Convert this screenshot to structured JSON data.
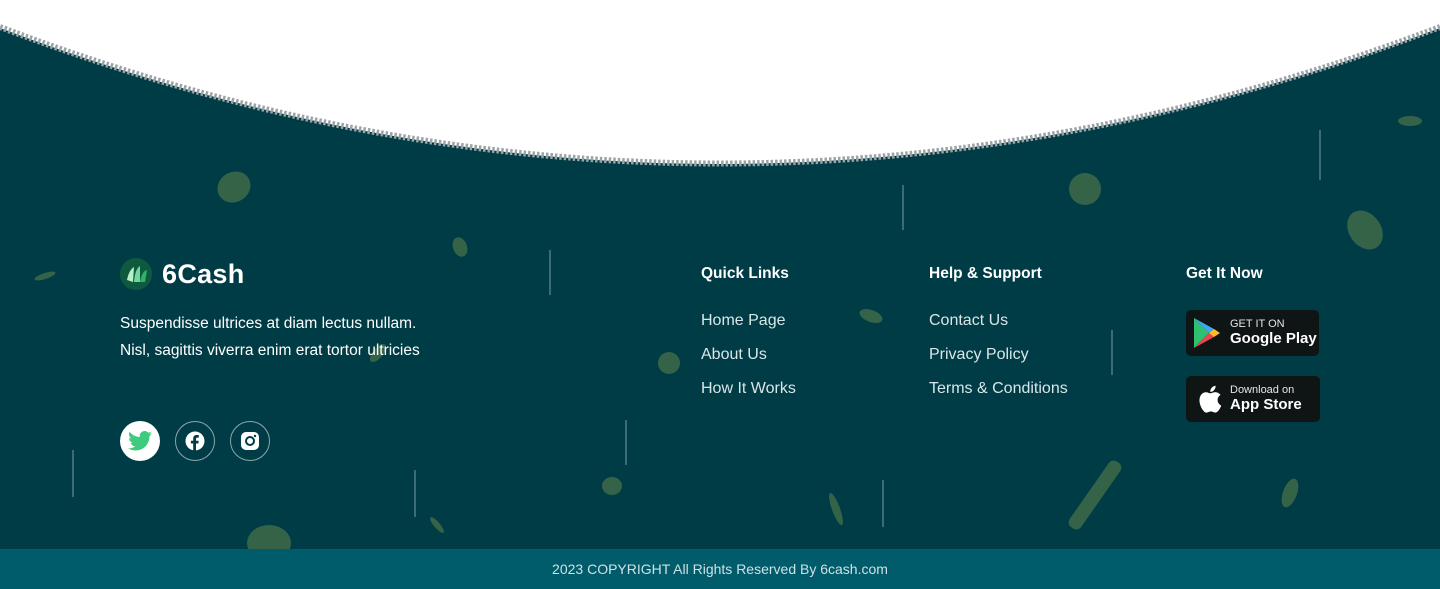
{
  "brand": {
    "name": "6Cash",
    "tagline": "Suspendisse ultrices at diam lectus nullam. Nisl, sagittis viverra enim erat tortor ultricies"
  },
  "social": [
    {
      "name": "twitter",
      "icon": "twitter-icon"
    },
    {
      "name": "facebook",
      "icon": "facebook-icon"
    },
    {
      "name": "instagram",
      "icon": "instagram-icon"
    }
  ],
  "quick_links": {
    "title": "Quick Links",
    "items": [
      "Home Page",
      "About Us",
      "How It Works"
    ]
  },
  "help_support": {
    "title": "Help & Support",
    "items": [
      "Contact Us",
      "Privacy Policy",
      "Terms & Conditions"
    ]
  },
  "get_it_now": {
    "title": "Get It Now",
    "google_play": {
      "small": "GET IT ON",
      "big": "Google Play"
    },
    "app_store": {
      "small": "Download on",
      "big": "App Store"
    }
  },
  "copyright": "2023 COPYRIGHT All Rights Reserved By 6cash.com",
  "colors": {
    "footer_bg": "#003c46",
    "bottom_bar": "#005b6a",
    "accent_green": "#2fb36b"
  }
}
